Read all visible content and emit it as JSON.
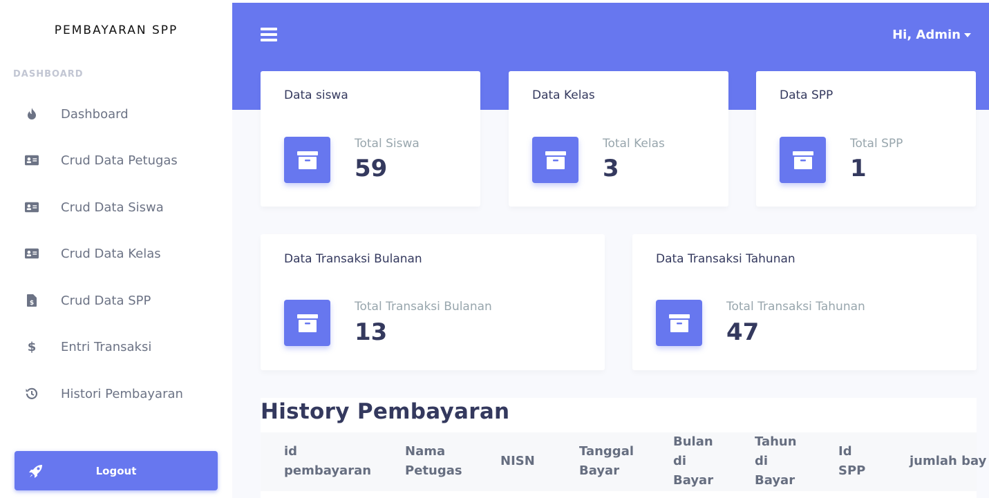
{
  "sidebar": {
    "brand": "PEMBAYARAN SPP",
    "section": "DASHBOARD",
    "items": [
      {
        "label": "Dashboard",
        "icon": "fire-icon"
      },
      {
        "label": "Crud Data Petugas",
        "icon": "id-card-icon"
      },
      {
        "label": "Crud Data Siswa",
        "icon": "id-card-icon"
      },
      {
        "label": "Crud Data Kelas",
        "icon": "id-card-icon"
      },
      {
        "label": "Crud Data SPP",
        "icon": "file-invoice-dollar-icon"
      },
      {
        "label": "Entri Transaksi",
        "icon": "dollar-sign-icon"
      },
      {
        "label": "Histori Pembayaran",
        "icon": "history-icon"
      }
    ],
    "logout_label": "Logout"
  },
  "header": {
    "user_label": "Hi, Admin"
  },
  "cards": [
    {
      "title": "Data siswa",
      "label": "Total Siswa",
      "value": "59",
      "icon": "archive-icon"
    },
    {
      "title": "Data Kelas",
      "label": "Total Kelas",
      "value": "3",
      "icon": "archive-icon"
    },
    {
      "title": "Data SPP",
      "label": "Total SPP",
      "value": "1",
      "icon": "archive-icon"
    },
    {
      "title": "Data Transaksi Bulanan",
      "label": "Total Transaksi Bulanan",
      "value": "13",
      "icon": "archive-icon"
    },
    {
      "title": "Data Transaksi Tahunan",
      "label": "Total Transaksi Tahunan",
      "value": "47",
      "icon": "archive-icon"
    }
  ],
  "history": {
    "title": "History Pembayaran",
    "columns": [
      "id\npembayaran",
      "Nama\nPetugas",
      "NISN",
      "Tanggal\nBayar",
      "Bulan\ndi\nBayar",
      "Tahun\ndi\nBayar",
      "Id\nSPP",
      "jumlah bay"
    ]
  },
  "colors": {
    "primary": "#6777ef",
    "background": "#f8f9fd",
    "text_dark": "#34395e",
    "text_muted": "#98a6ad"
  }
}
